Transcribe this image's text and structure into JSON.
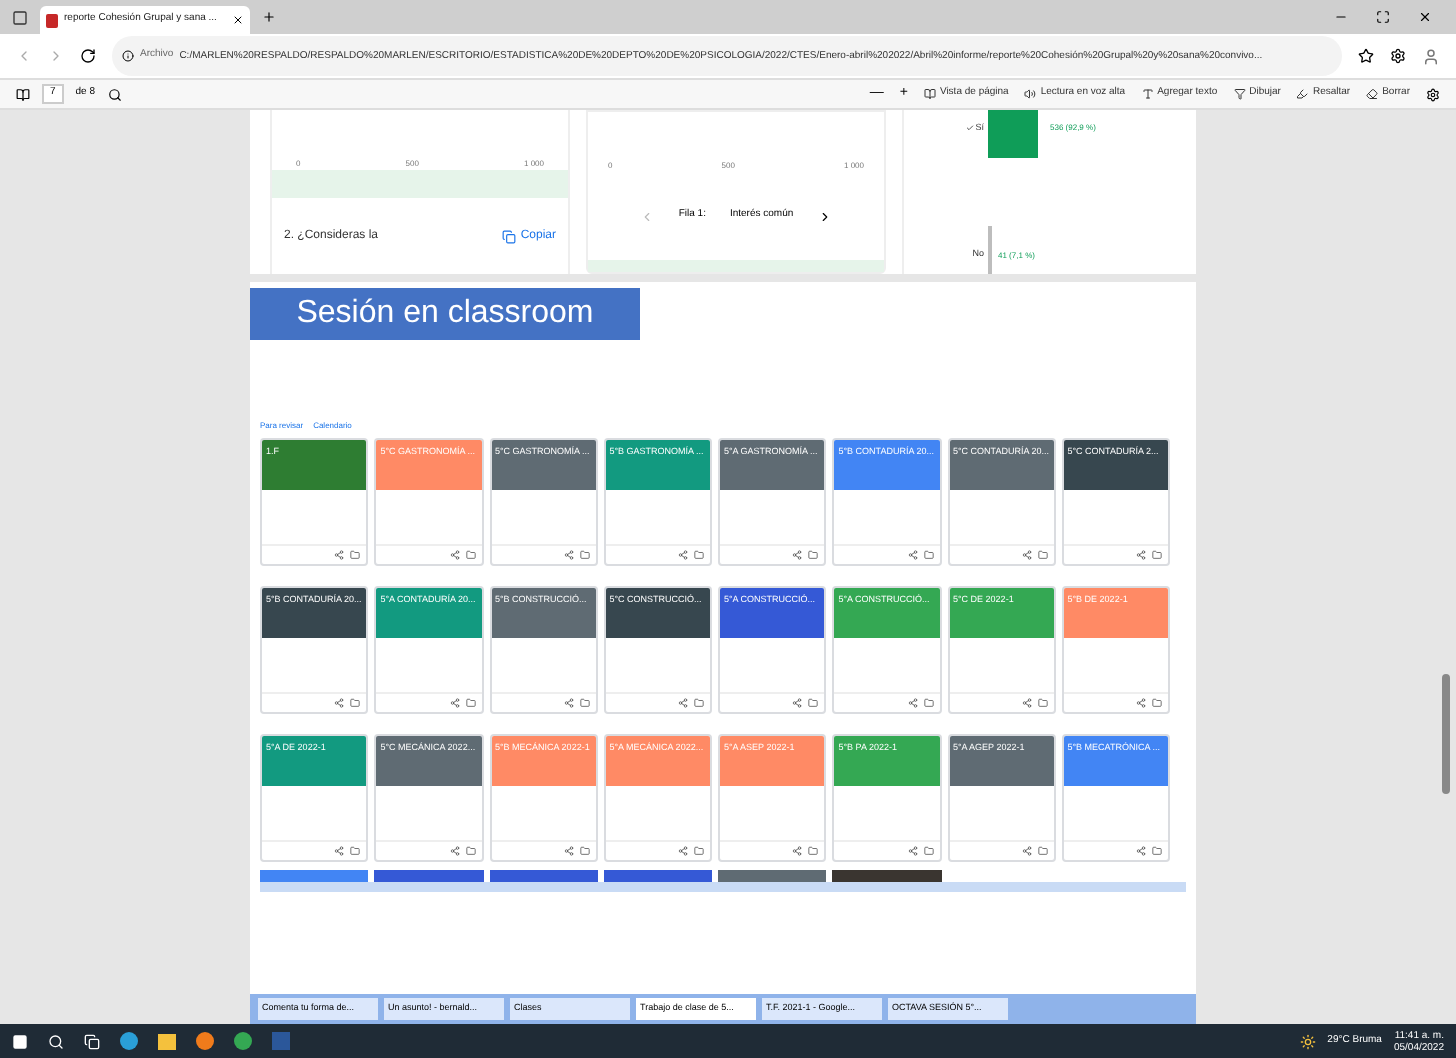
{
  "browser": {
    "tab_title": "reporte Cohesión Grupal y sana ...",
    "address_prefix": "Archivo",
    "address": "C:/MARLEN%20RESPALDO/RESPALDO%20MARLEN/ESCRITORIO/ESTADISTICA%20DE%20DEPTO%20DE%20PSICOLOGIA/2022/CTES/Enero-abril%202022/Abril%20informe/reporte%20Cohesión%20Grupal%20y%20sana%20convivo..."
  },
  "pdf_toolbar": {
    "page": "7",
    "page_total": "de 8",
    "zoom_out": "—",
    "zoom_in": "+",
    "tools": [
      {
        "kind": "view",
        "label": "Vista de página"
      },
      {
        "kind": "read",
        "label": "Lectura en voz alta"
      },
      {
        "kind": "text",
        "label": "Agregar texto"
      },
      {
        "kind": "draw",
        "label": "Dibujar"
      },
      {
        "kind": "highlight",
        "label": "Resaltar"
      },
      {
        "kind": "erase",
        "label": "Borrar"
      }
    ]
  },
  "form_results": {
    "panel_1": {
      "ticks": [
        "0",
        "500",
        "1 000"
      ],
      "question": "2. ¿Consideras la",
      "copy_button": "Copiar"
    },
    "panel_2": {
      "ticks": [
        "0",
        "500",
        "1 000"
      ],
      "row_label": "Fila 1:",
      "row_value": "Interés común"
    },
    "panel_3": {
      "bars": [
        {
          "label": "Sí",
          "value_label": "536 (92,9 %)"
        },
        {
          "label": "No",
          "value_label": "41 (7,1 %)"
        }
      ]
    }
  },
  "section_title": "Sesión en classroom",
  "classroom": {
    "links": [
      "Para revisar",
      "Calendario"
    ],
    "cards": [
      {
        "title": "1.F",
        "color": "#2e7d32"
      },
      {
        "title": "5°C GASTRONOMÍA ...",
        "color": "#ff8a65"
      },
      {
        "title": "5°C GASTRONOMÍA ...",
        "color": "#5f6b73"
      },
      {
        "title": "5°B GASTRONOMÍA ...",
        "color": "#129a80"
      },
      {
        "title": "5°A GASTRONOMÍA ...",
        "color": "#5f6b73"
      },
      {
        "title": "5°B CONTADURÍA 20...",
        "color": "#4285f4"
      },
      {
        "title": "5°C CONTADURÍA 20...",
        "color": "#5f6b73"
      },
      {
        "title": "5°C CONTADURÍA 2...",
        "color": "#37474f"
      },
      {
        "title": "5°B CONTADURÍA 20...",
        "color": "#37474f"
      },
      {
        "title": "5°A CONTADURÍA 20...",
        "color": "#129a80"
      },
      {
        "title": "5°B CONSTRUCCIÓ...",
        "color": "#5f6b73"
      },
      {
        "title": "5°C CONSTRUCCIÓ...",
        "color": "#37474f"
      },
      {
        "title": "5°A CONSTRUCCIÓ...",
        "color": "#3559d6"
      },
      {
        "title": "5°A CONSTRUCCIÓ...",
        "color": "#34a853"
      },
      {
        "title": "5°C DE 2022-1",
        "color": "#34a853"
      },
      {
        "title": "5°B DE 2022-1",
        "color": "#ff8a65"
      },
      {
        "title": "5°A DE 2022-1",
        "color": "#129a80"
      },
      {
        "title": "5°C MECÁNICA 2022...",
        "color": "#5f6b73"
      },
      {
        "title": "5°B MECÁNICA 2022-1",
        "color": "#ff8a65"
      },
      {
        "title": "5°A MECÁNICA 2022...",
        "color": "#ff8a65"
      },
      {
        "title": "5°A ASEP 2022-1",
        "color": "#ff8a65"
      },
      {
        "title": "5°B PA 2022-1",
        "color": "#34a853"
      },
      {
        "title": "5°A AGEP 2022-1",
        "color": "#5f6b73"
      },
      {
        "title": "5°B MECATRÓNICA ...",
        "color": "#4285f4"
      }
    ],
    "partial_cards": [
      {
        "color": "#4285f4"
      },
      {
        "color": "#3559d6"
      },
      {
        "color": "#3559d6"
      },
      {
        "color": "#3559d6"
      },
      {
        "color": "#5f6b73"
      },
      {
        "color": "#3a3530"
      }
    ]
  },
  "embedded_tabs": [
    {
      "title": "Comenta tu forma de...",
      "selected": false
    },
    {
      "title": "Un asunto! - bernald...",
      "selected": false
    },
    {
      "title": "Clases",
      "selected": false
    },
    {
      "title": "Trabajo de clase de 5...",
      "selected": true
    },
    {
      "title": "T.F. 2021-1 - Google...",
      "selected": false
    },
    {
      "title": "OCTAVA SESIÓN 5°...",
      "selected": false
    }
  ],
  "taskbar": {
    "weather": "29°C Bruma",
    "time": "11:41 a. m.",
    "date": "05/04/2022"
  }
}
